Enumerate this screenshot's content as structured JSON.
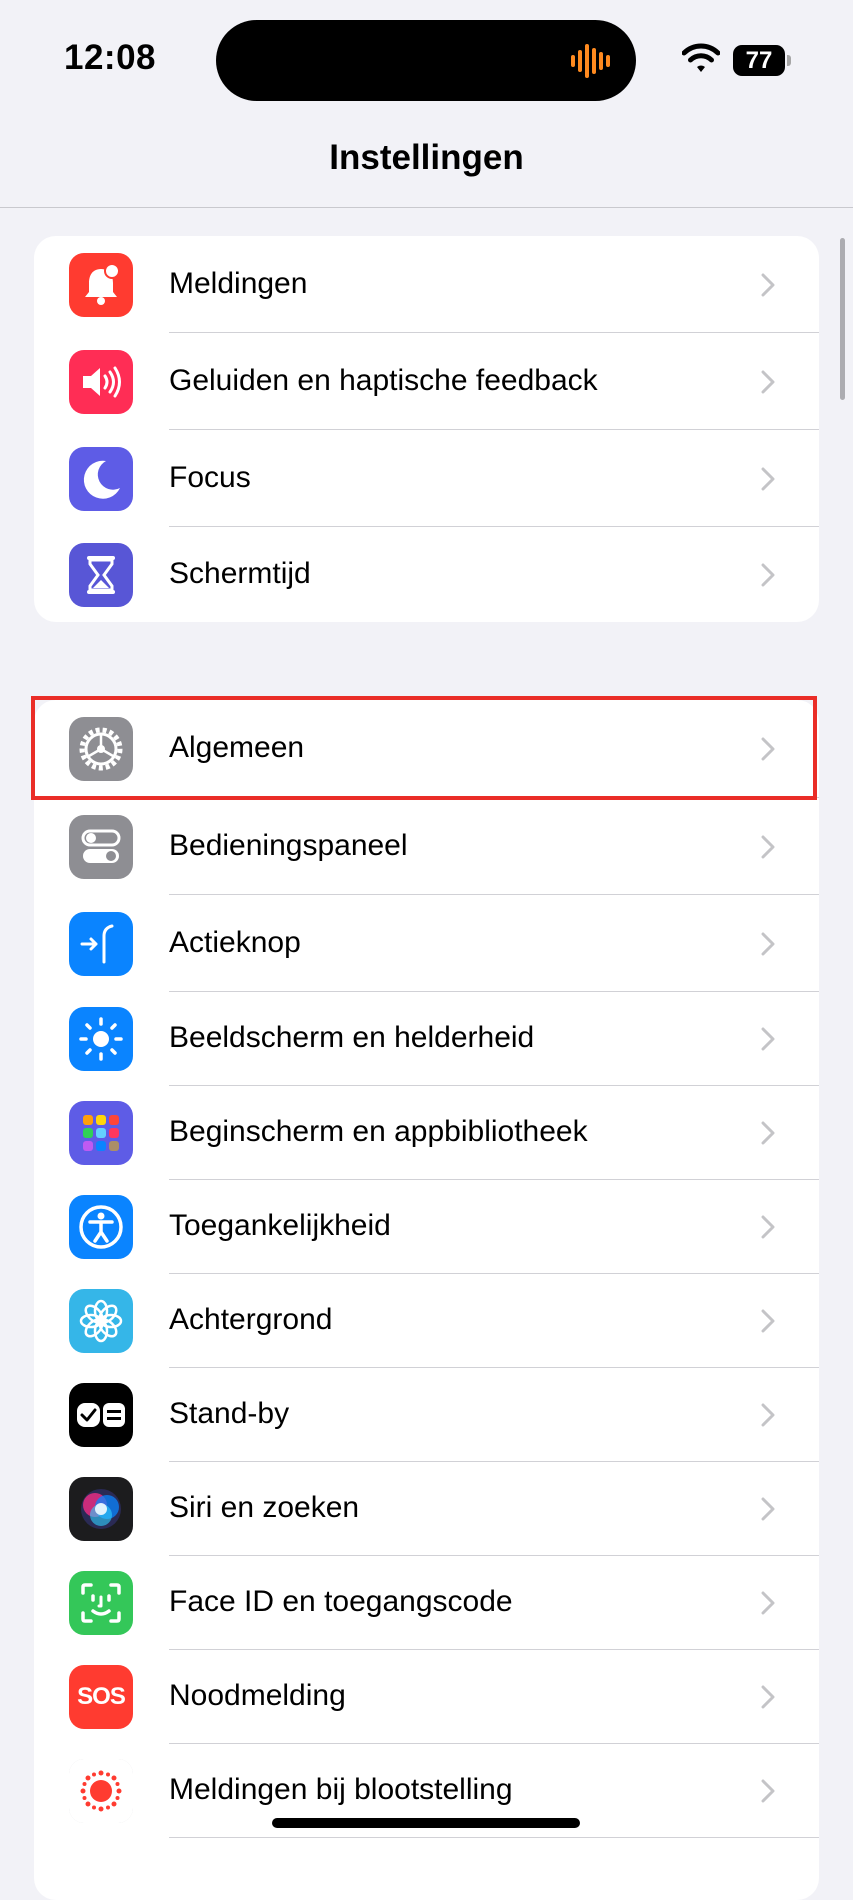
{
  "status_bar": {
    "time": "12:08",
    "battery_level": "77"
  },
  "nav": {
    "title": "Instellingen"
  },
  "groups": [
    {
      "items": [
        {
          "label": "Meldingen",
          "icon": "notifications-icon",
          "color": "#ff3b30"
        },
        {
          "label": "Geluiden en haptische feedback",
          "icon": "speaker-icon",
          "color": "#ff2d55"
        },
        {
          "label": "Focus",
          "icon": "moon-icon",
          "color": "#5e5ce6"
        },
        {
          "label": "Schermtijd",
          "icon": "hourglass-icon",
          "color": "#5856d6"
        }
      ]
    },
    {
      "items": [
        {
          "label": "Algemeen",
          "icon": "gear-icon",
          "color": "#8e8e93",
          "highlighted": true
        },
        {
          "label": "Bedieningspaneel",
          "icon": "toggles-icon",
          "color": "#8e8e93"
        },
        {
          "label": "Actieknop",
          "icon": "action-button-icon",
          "color": "#0a84ff"
        },
        {
          "label": "Beeldscherm en helderheid",
          "icon": "sun-icon",
          "color": "#0a84ff"
        },
        {
          "label": "Beginscherm en appbibliotheek",
          "icon": "app-grid-icon",
          "color": "#5e5ce6"
        },
        {
          "label": "Toegankelijkheid",
          "icon": "accessibility-icon",
          "color": "#0a84ff"
        },
        {
          "label": "Achtergrond",
          "icon": "flower-icon",
          "color": "#35b6e8"
        },
        {
          "label": "Stand-by",
          "icon": "standby-icon",
          "color": "#000000"
        },
        {
          "label": "Siri en zoeken",
          "icon": "siri-icon",
          "color": "#1c1c1e"
        },
        {
          "label": "Face ID en toegangscode",
          "icon": "face-id-icon",
          "color": "#34c759"
        },
        {
          "label": "Noodmelding",
          "icon": "sos-icon",
          "color": "#ff3b30",
          "icon_text": "SOS"
        },
        {
          "label": "Meldingen bij blootstelling",
          "icon": "exposure-icon",
          "color": "#ffffff"
        }
      ]
    }
  ]
}
